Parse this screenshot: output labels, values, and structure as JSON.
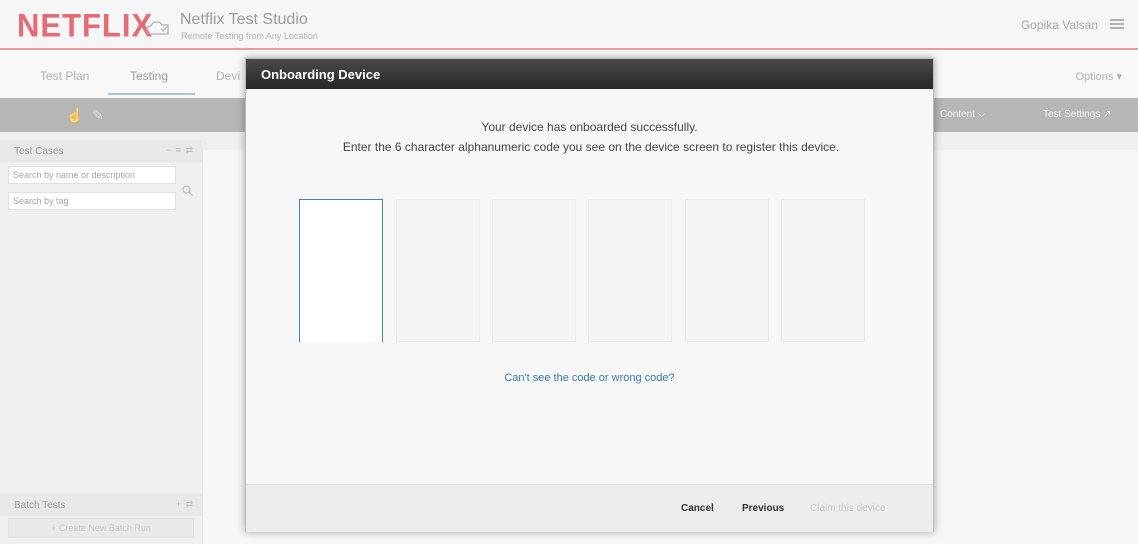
{
  "header": {
    "logo": "NETFLIX",
    "title": "Netflix Test Studio",
    "subtitle": "Remote Testing from Any Location",
    "user": "Gopika Valsan"
  },
  "tabs": [
    {
      "label": "Test Plan"
    },
    {
      "label": "Testing"
    },
    {
      "label": "Devi"
    }
  ],
  "options_label": "Options ▾",
  "toolbar": {
    "content_label": "Content ⌵",
    "test_settings_label": "Test Settings ↗"
  },
  "sidebar": {
    "test_cases_label": "Test Cases",
    "test_cases_controls": "− ≡ ⇄",
    "search_placeholder": "Search by name or description",
    "tag_placeholder": "Search by tag",
    "batch_tests_label": "Batch Tests",
    "batch_tests_controls": "+ ⇄",
    "create_batch_label": "+ Create New Batch Run"
  },
  "modal": {
    "title": "Onboarding Device",
    "message_success": "Your device has onboarded successfully.",
    "message_instructions": "Enter the 6 character alphanumeric code you see on the device screen to register this device.",
    "code_boxes": [
      "",
      "",
      "",
      "",
      "",
      ""
    ],
    "help_link": "Can't see the code or wrong code?",
    "cancel_label": "Cancel",
    "previous_label": "Previous",
    "claim_label": "Claim this device"
  }
}
